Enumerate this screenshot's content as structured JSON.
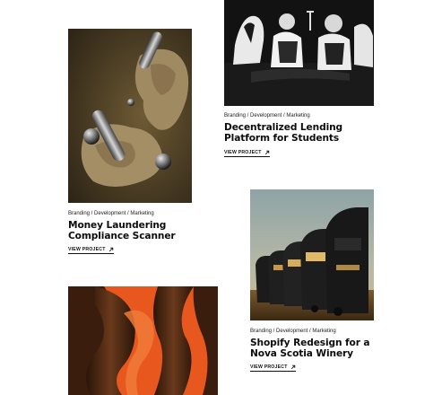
{
  "projects": [
    {
      "id": "lending",
      "tags": "Branding / Development / Marketing",
      "title_line1": "Decentralized Lending",
      "title_line2": "Platform for Students",
      "link_label": "VIEW PROJECT",
      "image_desc_icon": "engraving-figures-image"
    },
    {
      "id": "laundering",
      "tags": "Branding / Development / Marketing",
      "title_line1": "Money Laundering",
      "title_line2": "Compliance Scanner",
      "link_label": "VIEW PROJECT",
      "image_desc_icon": "floating-rocks-image"
    },
    {
      "id": "winery",
      "tags": "Branding / Development / Marketing",
      "title_line1": "Shopify Redesign for a",
      "title_line2": "Nova Scotia Winery",
      "link_label": "VIEW PROJECT",
      "image_desc_icon": "tour-buses-image"
    },
    {
      "id": "abstract",
      "image_desc_icon": "orange-abstract-image"
    }
  ],
  "colors": {
    "text": "#111111",
    "background": "#ffffff",
    "accent_orange": "#e8571d"
  }
}
